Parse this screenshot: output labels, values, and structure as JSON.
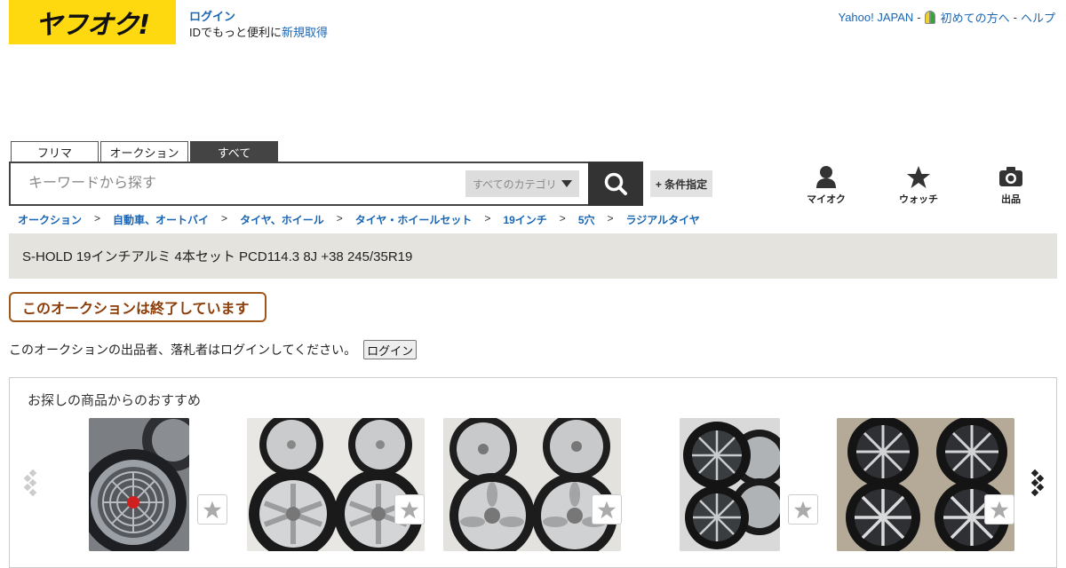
{
  "logo": {
    "text": "ヤフオク!",
    "bg_color": "#ffd90f"
  },
  "login_box": {
    "login_label": "ログイン",
    "prefix_text": "IDでもっと便利に",
    "register_label": "新規取得"
  },
  "top_links": {
    "yahoo": "Yahoo! JAPAN",
    "beginner": "初めての方へ",
    "help": "ヘルプ",
    "separator": "-"
  },
  "search": {
    "tabs": [
      {
        "label": "フリマ",
        "active": false
      },
      {
        "label": "オークション",
        "active": false
      },
      {
        "label": "すべて",
        "active": true
      }
    ],
    "placeholder": "キーワードから探す",
    "category_label": "すべてのカテゴリ",
    "condition_label": "+ 条件指定"
  },
  "quick_links": [
    {
      "label": "マイオク",
      "icon": "person-icon"
    },
    {
      "label": "ウォッチ",
      "icon": "star-icon"
    },
    {
      "label": "出品",
      "icon": "camera-icon"
    }
  ],
  "breadcrumb": [
    "オークション",
    "自動車、オートバイ",
    "タイヤ、ホイール",
    "タイヤ・ホイールセット",
    "19インチ",
    "5穴",
    "ラジアルタイヤ"
  ],
  "breadcrumb_separator": ">",
  "item_title": "S-HOLD 19インチアルミ 4本セット PCD114.3 8J +38 245/35R19",
  "status_badge": "このオークションは終了しています",
  "login_notice": {
    "text": "このオークションの出品者、落札者はログインしてください。",
    "button": "ログイン"
  },
  "recommendations": {
    "heading": "お探しの商品からのおすすめ",
    "items": [
      {
        "icon": "wheel-photo"
      },
      {
        "icon": "wheel-photo"
      },
      {
        "icon": "wheel-photo"
      },
      {
        "icon": "wheel-photo"
      },
      {
        "icon": "wheel-photo"
      }
    ]
  },
  "colors": {
    "link": "#1a66b3",
    "title_bar": "#e5e3dd",
    "badge_border": "#a0581a",
    "badge_text": "#8b3d0a"
  }
}
